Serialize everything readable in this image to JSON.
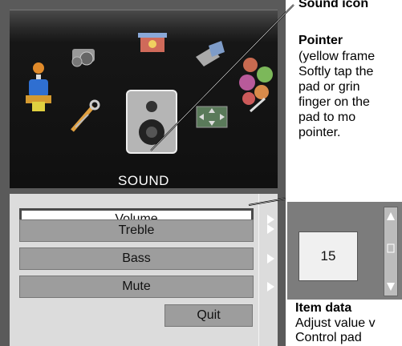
{
  "osd": {
    "section_label": "SOUND",
    "menu": {
      "items": [
        {
          "label": "Volume",
          "selected": true
        },
        {
          "label": "Treble",
          "selected": false
        },
        {
          "label": "Bass",
          "selected": false
        },
        {
          "label": "Mute",
          "selected": false
        }
      ],
      "quit_label": "Quit"
    },
    "value": "15"
  },
  "annotations": {
    "sound_icon": "Sound icon",
    "pointer_title": "Pointer",
    "pointer_lines": [
      "(yellow frame",
      "Softly tap the",
      "pad or grin",
      "finger on the",
      "pad to mo",
      "pointer."
    ],
    "item_data_title": "Item data",
    "item_data_lines": [
      "Adjust value v",
      "Control pad"
    ]
  },
  "colors": {
    "panel_bg": "#5a5a5a",
    "menu_bg": "#dcdcdc",
    "item_bg": "#9d9d9d",
    "selected_bg": "#ffffff"
  }
}
